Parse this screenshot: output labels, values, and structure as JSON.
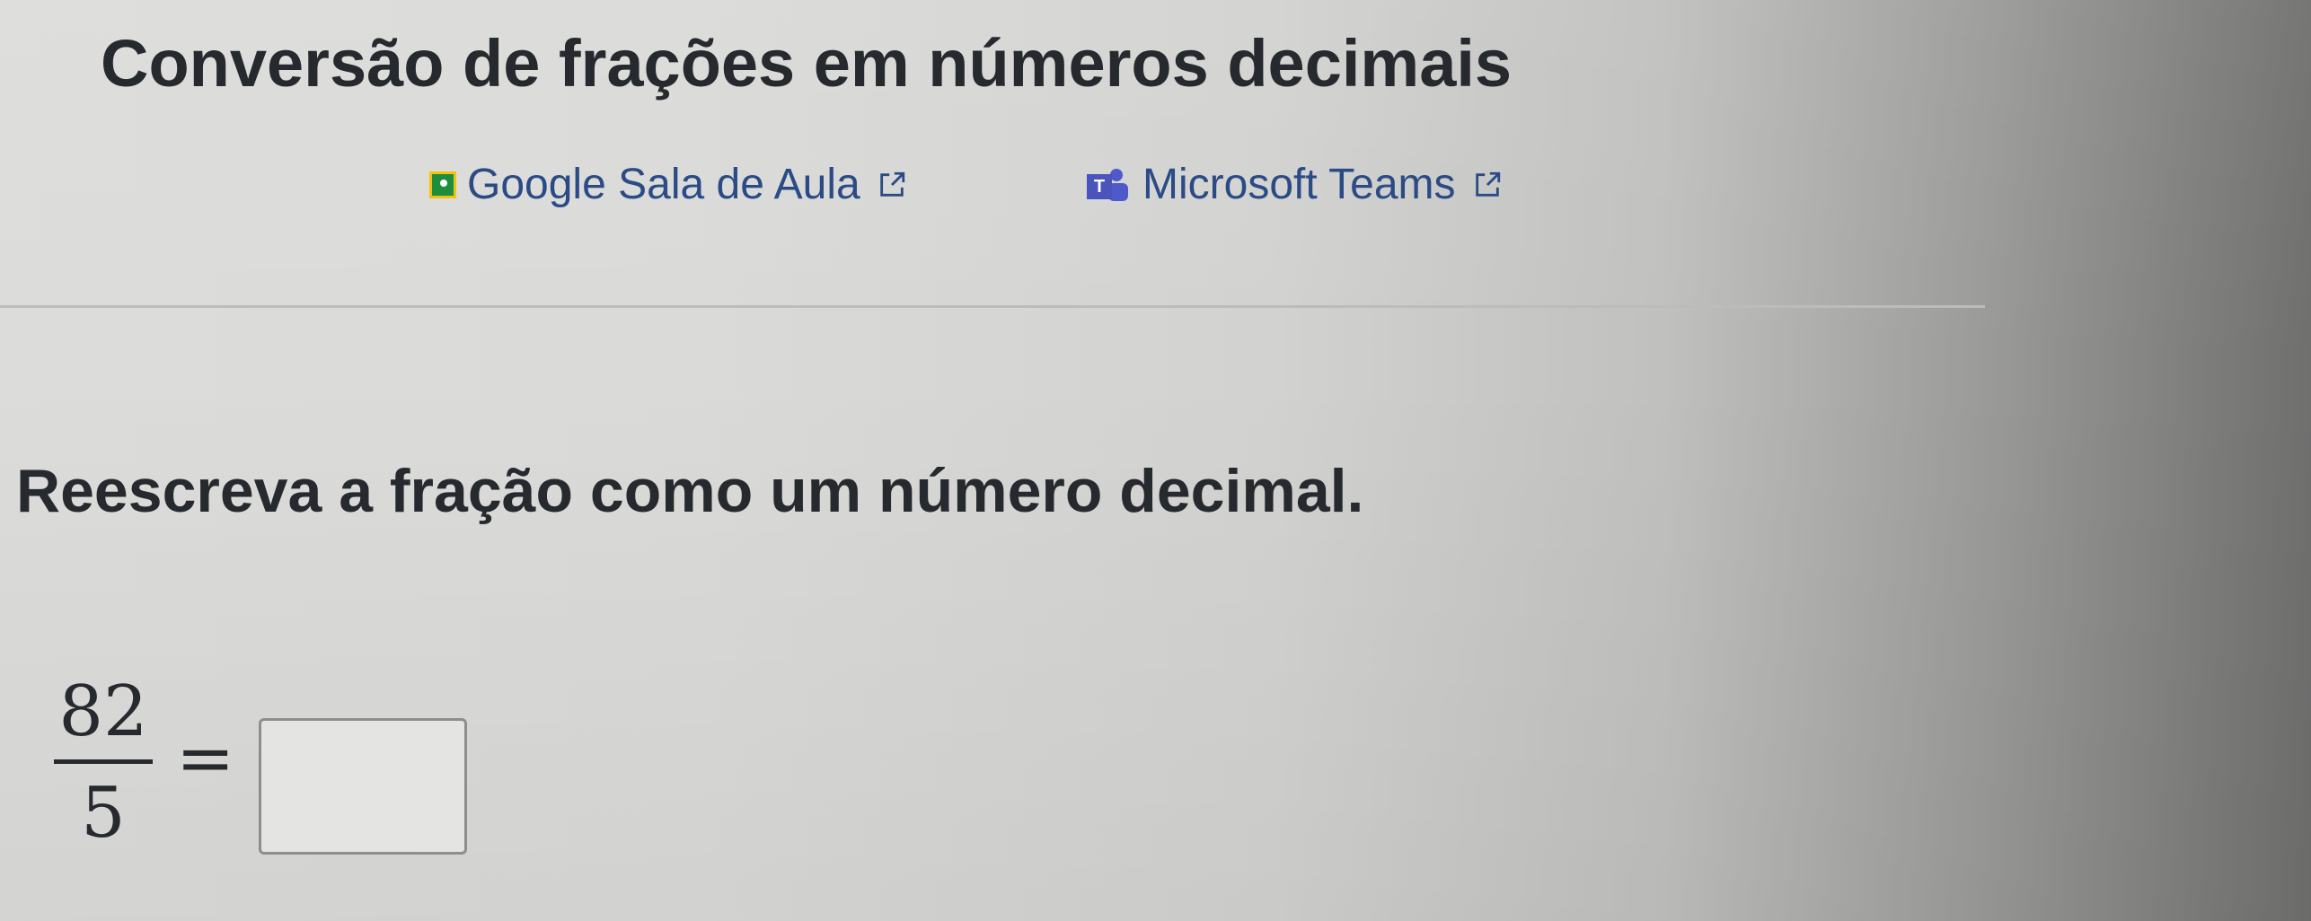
{
  "page": {
    "title": "Conversão de frações em números decimais"
  },
  "share_links": [
    {
      "label": "Google Sala de Aula",
      "icon": "google-classroom-icon",
      "external_icon": "external-link-icon"
    },
    {
      "label": "Microsoft Teams",
      "icon": "microsoft-teams-icon",
      "external_icon": "external-link-icon"
    }
  ],
  "exercise": {
    "instruction": "Reescreva a fração como um número decimal.",
    "numerator": "82",
    "denominator": "5",
    "equals": "=",
    "answer_value": ""
  },
  "colors": {
    "text": "#262a2e",
    "link": "#2a4b86",
    "classroom_green": "#1e8e3e",
    "teams_purple": "#4b53bc"
  }
}
